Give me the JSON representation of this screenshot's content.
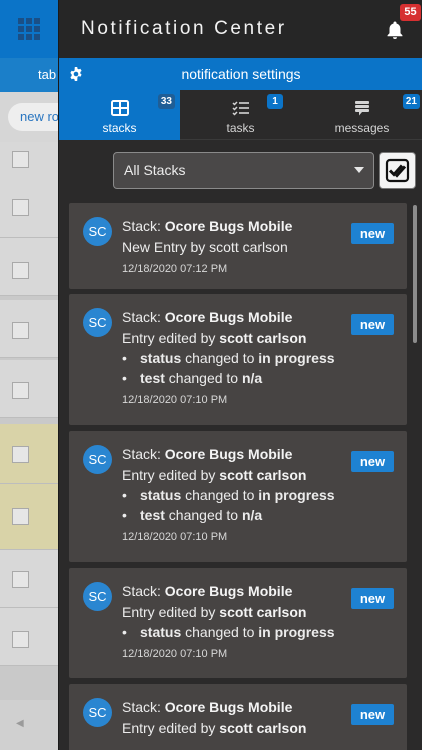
{
  "background": {
    "tab_partial": "tab",
    "new_row_partial": "new ro"
  },
  "panel": {
    "title": "Notification Center",
    "bell_badge": "55"
  },
  "settings_bar": {
    "label": "notification settings"
  },
  "tabs": [
    {
      "label": "stacks",
      "badge": "33",
      "active": true,
      "icon": "grid-icon"
    },
    {
      "label": "tasks",
      "badge": "1",
      "active": false,
      "icon": "checklist-icon"
    },
    {
      "label": "messages",
      "badge": "21",
      "active": false,
      "icon": "message-icon"
    }
  ],
  "filter": {
    "selected": "All Stacks"
  },
  "notifications": [
    {
      "avatar": "SC",
      "badge": "new",
      "stack_prefix": "Stack: ",
      "stack_name": "Ocore Bugs Mobile",
      "action": "New Entry by scott carlson",
      "date": "12/18/2020 07:12 PM"
    },
    {
      "avatar": "SC",
      "badge": "new",
      "stack_prefix": "Stack: ",
      "stack_name": "Ocore Bugs Mobile",
      "action_prefix": "Entry edited by ",
      "action_user": "scott carlson",
      "changes": [
        {
          "field": "status",
          "mid": " changed to ",
          "value": "in progress"
        },
        {
          "field": "test",
          "mid": " changed to ",
          "value": "n/a"
        }
      ],
      "date": "12/18/2020 07:10 PM"
    },
    {
      "avatar": "SC",
      "badge": "new",
      "stack_prefix": "Stack: ",
      "stack_name": "Ocore Bugs Mobile",
      "action_prefix": "Entry edited by ",
      "action_user": "scott carlson",
      "changes": [
        {
          "field": "status",
          "mid": " changed to ",
          "value": "in progress"
        },
        {
          "field": "test",
          "mid": " changed to ",
          "value": "n/a"
        }
      ],
      "date": "12/18/2020 07:10 PM"
    },
    {
      "avatar": "SC",
      "badge": "new",
      "stack_prefix": "Stack: ",
      "stack_name": "Ocore Bugs Mobile",
      "action_prefix": "Entry edited by ",
      "action_user": "scott carlson",
      "changes": [
        {
          "field": "status",
          "mid": " changed to ",
          "value": "in progress"
        }
      ],
      "date": "12/18/2020 07:10 PM"
    },
    {
      "avatar": "SC",
      "badge": "new",
      "stack_prefix": "Stack: ",
      "stack_name": "Ocore Bugs Mobile",
      "action_prefix": "Entry edited by ",
      "action_user": "scott carlson",
      "changes": [],
      "date": ""
    }
  ],
  "colors": {
    "accent": "#0b74c8",
    "panel_bg": "#2b2a2a",
    "card_bg": "#474443",
    "badge_red": "#d63031"
  }
}
